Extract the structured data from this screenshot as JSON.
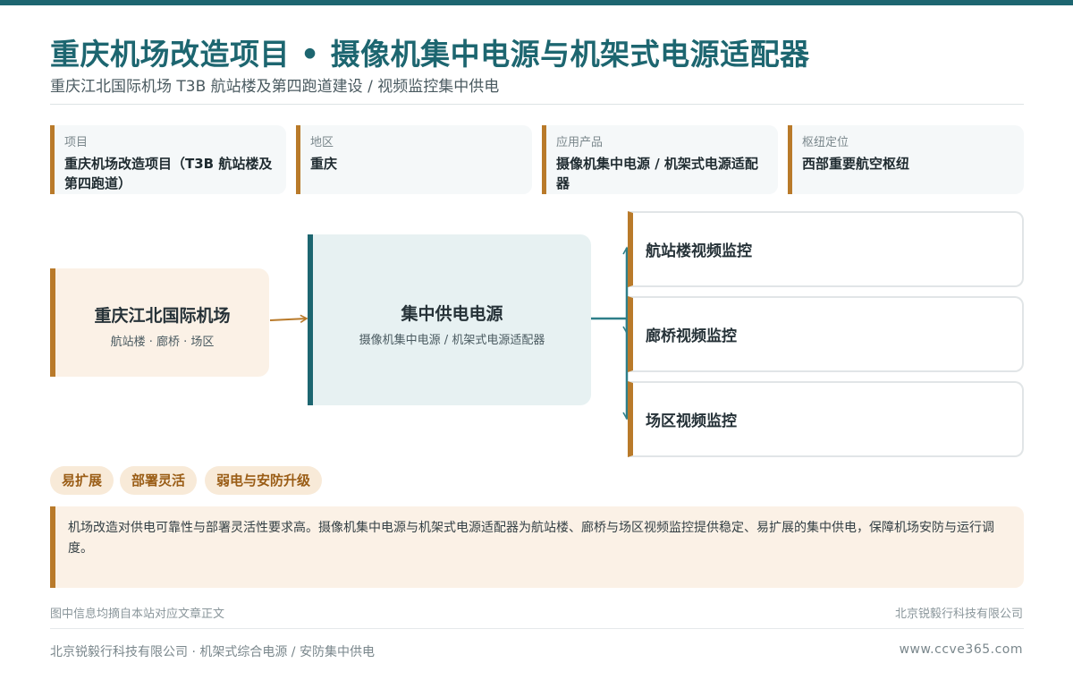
{
  "header": {
    "title": "重庆机场改造项目 • 摄像机集中电源与机架式电源适配器",
    "subtitle": "重庆江北国际机场 T3B 航站楼及第四跑道建设 / 视频监控集中供电"
  },
  "info_cards": [
    {
      "label": "项目",
      "value": "重庆机场改造项目（T3B 航站楼及第四跑道）"
    },
    {
      "label": "地区",
      "value": "重庆"
    },
    {
      "label": "应用产品",
      "value": "摄像机集中电源 / 机架式电源适配器"
    },
    {
      "label": "枢纽定位",
      "value": "西部重要航空枢纽"
    }
  ],
  "diagram": {
    "source": {
      "title": "重庆江北国际机场",
      "subtitle": "航站楼 · 廊桥 · 场区"
    },
    "center": {
      "title": "集中供电电源",
      "subtitle": "摄像机集中电源 / 机架式电源适配器"
    },
    "outputs": [
      "航站楼视频监控",
      "廊桥视频监控",
      "场区视频监控"
    ]
  },
  "tags": [
    "易扩展",
    "部署灵活",
    "弱电与安防升级"
  ],
  "description": "机场改造对供电可靠性与部署灵活性要求高。摄像机集中电源与机架式电源适配器为航站楼、廊桥与场区视频监控提供稳定、易扩展的集中供电，保障机场安防与运行调度。",
  "notes": {
    "left": "图中信息均摘自本站对应文章正文",
    "right": "北京锐毅行科技有限公司"
  },
  "footer": {
    "left": "北京锐毅行科技有限公司 · 机架式综合电源 / 安防集中供电",
    "right": "www.ccve365.com"
  },
  "colors": {
    "brand_teal": "#1d6670",
    "accent_orange": "#b97a2a",
    "source_fill": "#fbf1e6",
    "center_fill": "#e7f1f2"
  }
}
